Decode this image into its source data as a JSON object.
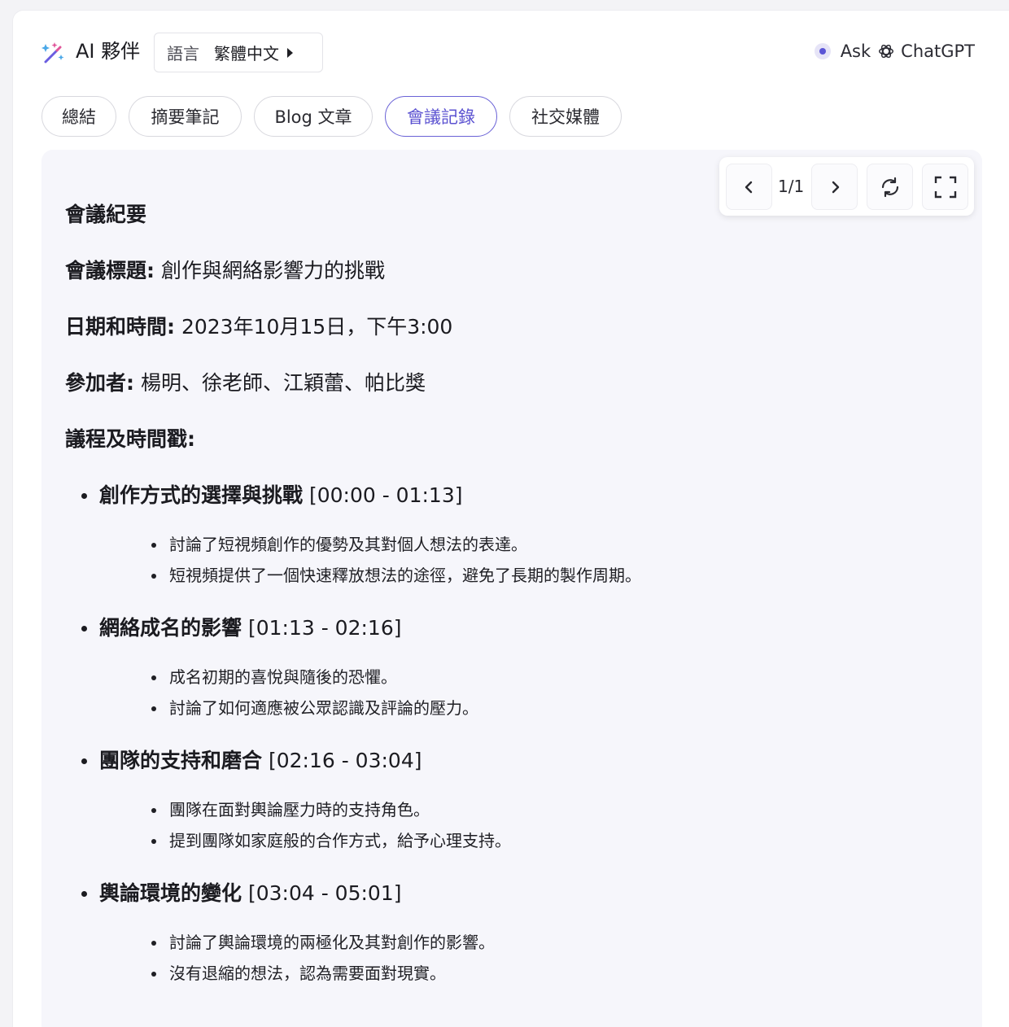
{
  "header": {
    "brand_title": "AI 夥伴",
    "language_label": "語言",
    "language_value": "繁體中文",
    "ask_label": "Ask",
    "chatgpt_label": "ChatGPT"
  },
  "tabs": [
    {
      "label": "總結",
      "active": false
    },
    {
      "label": "摘要筆記",
      "active": false
    },
    {
      "label": "Blog 文章",
      "active": false
    },
    {
      "label": "會議記錄",
      "active": true
    },
    {
      "label": "社交媒體",
      "active": false
    }
  ],
  "toolbar": {
    "page_indicator": "1/1"
  },
  "document": {
    "heading": "會議紀要",
    "title_label": "會議標題:",
    "title_value": "創作與網絡影響力的挑戰",
    "datetime_label": "日期和時間:",
    "datetime_value": "2023年10月15日，下午3:00",
    "attendees_label": "參加者:",
    "attendees_value": "楊明、徐老師、江穎蕾、帕比獎",
    "agenda_label": "議程及時間戳:",
    "sections": [
      {
        "name": "創作方式的選擇與挑戰",
        "time": "[00:00 - 01:13]",
        "items": [
          "討論了短視頻創作的優勢及其對個人想法的表達。",
          "短視頻提供了一個快速釋放想法的途徑，避免了長期的製作周期。"
        ]
      },
      {
        "name": "網絡成名的影響",
        "time": "[01:13 - 02:16]",
        "items": [
          "成名初期的喜悅與隨後的恐懼。",
          "討論了如何適應被公眾認識及評論的壓力。"
        ]
      },
      {
        "name": "團隊的支持和磨合",
        "time": "[02:16 - 03:04]",
        "items": [
          "團隊在面對輿論壓力時的支持角色。",
          "提到團隊如家庭般的合作方式，給予心理支持。"
        ]
      },
      {
        "name": "輿論環境的變化",
        "time": "[03:04 - 05:01]",
        "items": [
          "討論了輿論環境的兩極化及其對創作的影響。",
          "沒有退縮的想法，認為需要面對現實。"
        ]
      }
    ]
  },
  "colors": {
    "accent": "#5b52d1",
    "panel_bg": "#f6f6fb"
  },
  "icons": [
    "magic-sparkle-icon",
    "caret-right-icon",
    "status-dot-icon",
    "openai-logo-icon",
    "chevron-left-icon",
    "chevron-right-icon",
    "refresh-icon",
    "fullscreen-icon"
  ]
}
